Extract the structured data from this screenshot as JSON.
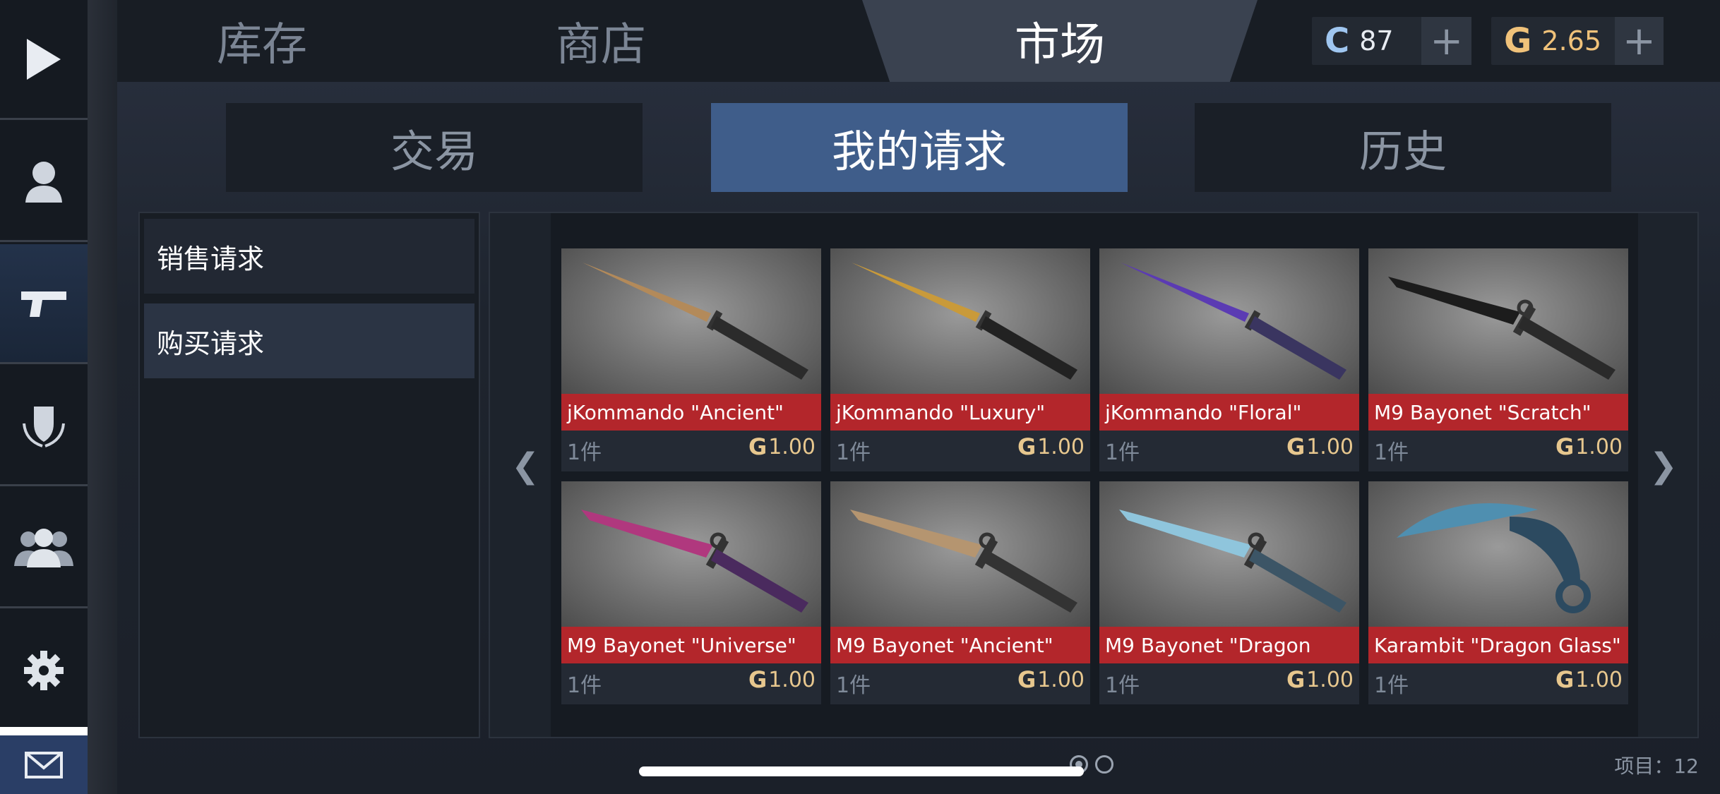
{
  "top_tabs": [
    {
      "label": "库存",
      "active": false
    },
    {
      "label": "商店",
      "active": false
    },
    {
      "label": "市场",
      "active": true
    }
  ],
  "currencies": {
    "credits": {
      "icon": "C",
      "value": "87",
      "color": "#9fc6f0"
    },
    "gold": {
      "icon": "G",
      "value": "2.65",
      "color": "#f0c27a"
    }
  },
  "sub_tabs": [
    {
      "label": "交易",
      "active": false
    },
    {
      "label": "我的请求",
      "active": true
    },
    {
      "label": "历史",
      "active": false
    }
  ],
  "requests_menu": [
    {
      "label": "销售请求",
      "active": false
    },
    {
      "label": "购买请求",
      "active": true
    }
  ],
  "sidebar": {
    "items": [
      "play-icon",
      "profile-icon",
      "pistol-icon",
      "shield-wreath-icon",
      "friends-icon",
      "gear-icon"
    ],
    "active_index": 2,
    "mail": "mail-icon"
  },
  "nav": {
    "prev": "❮",
    "next": "❯"
  },
  "items": [
    {
      "name": "jKommando \"Ancient\"",
      "qty": "1件",
      "currency": "G",
      "price": "1.00",
      "blade": "#b38a5a",
      "handle": "#2b2b2b",
      "shape": "dagger"
    },
    {
      "name": "jKommando \"Luxury\"",
      "qty": "1件",
      "currency": "G",
      "price": "1.00",
      "blade": "#c99a3a",
      "handle": "#222222",
      "shape": "dagger"
    },
    {
      "name": "jKommando \"Floral\"",
      "qty": "1件",
      "currency": "G",
      "price": "1.00",
      "blade": "#5b3bb3",
      "handle": "#3a3560",
      "shape": "dagger"
    },
    {
      "name": "M9 Bayonet \"Scratch\"",
      "qty": "1件",
      "currency": "G",
      "price": "1.00",
      "blade": "#1c1c1c",
      "handle": "#2a2a2a",
      "shape": "bayonet"
    },
    {
      "name": "M9 Bayonet \"Universe\"",
      "qty": "1件",
      "currency": "G",
      "price": "1.00",
      "blade": "#b0387e",
      "handle": "#4a2a5e",
      "shape": "bayonet"
    },
    {
      "name": "M9 Bayonet \"Ancient\"",
      "qty": "1件",
      "currency": "G",
      "price": "1.00",
      "blade": "#b59570",
      "handle": "#333333",
      "shape": "bayonet"
    },
    {
      "name": "M9 Bayonet \"Dragon",
      "qty": "1件",
      "currency": "G",
      "price": "1.00",
      "blade": "#8fc5dc",
      "handle": "#3c5566",
      "shape": "bayonet"
    },
    {
      "name": "Karambit \"Dragon Glass\"",
      "qty": "1件",
      "currency": "G",
      "price": "1.00",
      "blade": "#4f8fb0",
      "handle": "#2c4a60",
      "shape": "karambit"
    }
  ],
  "pagination": {
    "pages": 2,
    "current": 1
  },
  "items_count": "项目：12"
}
